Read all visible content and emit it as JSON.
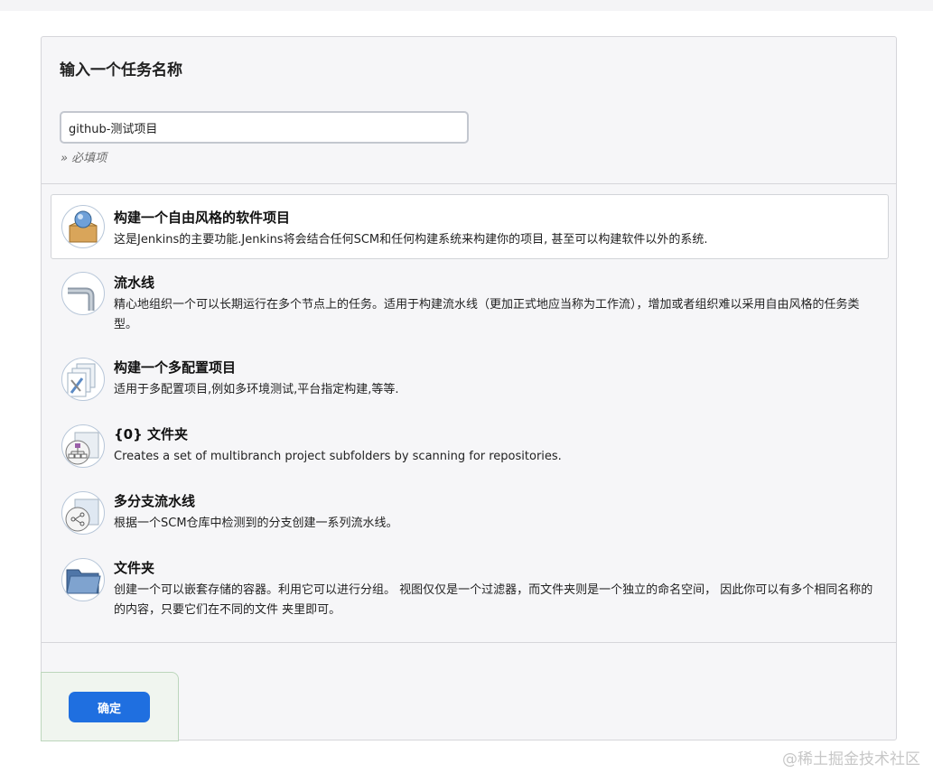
{
  "page": {
    "title": "输入一个任务名称"
  },
  "name_input": {
    "value": "github-测试项目",
    "required_hint": "» 必填项"
  },
  "item_types": [
    {
      "title": "构建一个自由风格的软件项目",
      "description": "这是Jenkins的主要功能.Jenkins将会结合任何SCM和任何构建系统来构建你的项目, 甚至可以构建软件以外的系统.",
      "icon": "freestyle-project-icon",
      "selected": true
    },
    {
      "title": "流水线",
      "description": "精心地组织一个可以长期运行在多个节点上的任务。适用于构建流水线（更加正式地应当称为工作流），增加或者组织难以采用自由风格的任务类型。",
      "icon": "pipeline-icon",
      "selected": false
    },
    {
      "title": "构建一个多配置项目",
      "description": "适用于多配置项目,例如多环境测试,平台指定构建,等等.",
      "icon": "multi-config-icon",
      "selected": false
    },
    {
      "title": "{0} 文件夹",
      "description": "Creates a set of multibranch project subfolders by scanning for repositories.",
      "icon": "organization-folder-icon",
      "selected": false
    },
    {
      "title": "多分支流水线",
      "description": "根据一个SCM仓库中检测到的分支创建一系列流水线。",
      "icon": "multibranch-pipeline-icon",
      "selected": false
    },
    {
      "title": "文件夹",
      "description": "创建一个可以嵌套存储的容器。利用它可以进行分组。 视图仅仅是一个过滤器，而文件夹则是一个独立的命名空间， 因此你可以有多个相同名称的的内容，只要它们在不同的文件 夹里即可。",
      "icon": "folder-icon",
      "selected": false
    }
  ],
  "footer": {
    "ok_label": "确定"
  },
  "watermark": "@稀土掘金技术社区",
  "colors": {
    "accent": "#1f6fe0",
    "panel_bg": "#f6f6f8"
  }
}
